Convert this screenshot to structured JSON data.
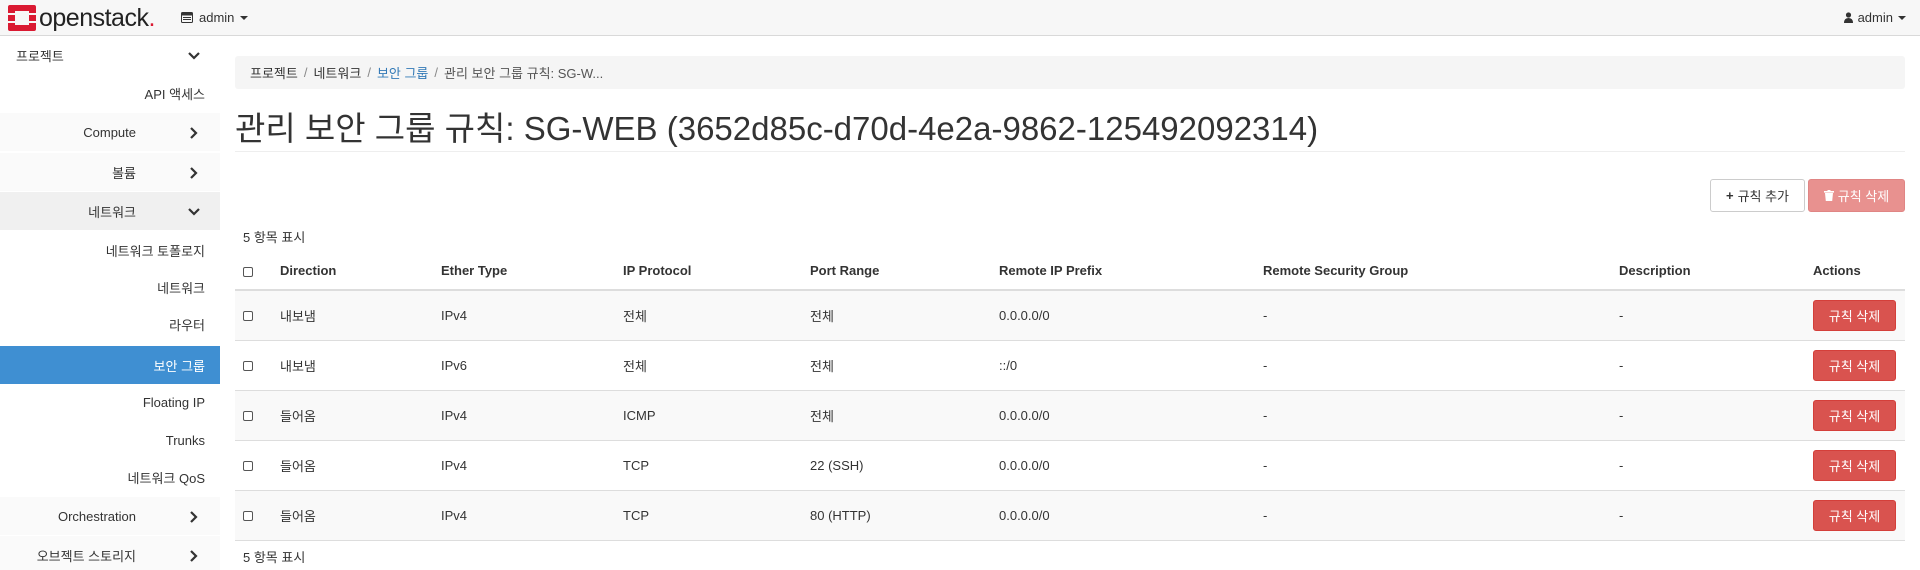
{
  "navbar": {
    "brand": "openstack",
    "brand_dot": ".",
    "project_label": "admin",
    "user_label": "admin"
  },
  "sidebar": {
    "items": [
      {
        "label": "프로젝트"
      },
      {
        "label": "API 액세스"
      },
      {
        "label": "Compute"
      },
      {
        "label": "볼륨"
      },
      {
        "label": "네트워크"
      },
      {
        "label": "네트워크 토폴로지"
      },
      {
        "label": "네트워크"
      },
      {
        "label": "라우터"
      },
      {
        "label": "보안 그룹"
      },
      {
        "label": "Floating IP"
      },
      {
        "label": "Trunks"
      },
      {
        "label": "네트워크 QoS"
      },
      {
        "label": "Orchestration"
      },
      {
        "label": "오브젝트 스토리지"
      }
    ]
  },
  "breadcrumb": {
    "items": [
      "프로젝트",
      "네트워크",
      "보안 그룹",
      "관리 보안 그룹 규칙: SG-W..."
    ],
    "separator": "/"
  },
  "page_title": "관리 보안 그룹 규칙: SG-WEB (3652d85c-d70d-4e2a-9862-125492092314)",
  "actions": {
    "add_label": "규칙 추가",
    "delete_label": "규칙 삭제"
  },
  "count_text": "5 항목 표시",
  "table": {
    "columns": [
      "Direction",
      "Ether Type",
      "IP Protocol",
      "Port Range",
      "Remote IP Prefix",
      "Remote Security Group",
      "Description",
      "Actions"
    ],
    "rows": [
      {
        "direction": "내보냄",
        "ether": "IPv4",
        "protocol": "전체",
        "port": "전체",
        "prefix": "0.0.0.0/0",
        "group": "-",
        "desc": "-",
        "action": "규칙 삭제"
      },
      {
        "direction": "내보냄",
        "ether": "IPv6",
        "protocol": "전체",
        "port": "전체",
        "prefix": "::/0",
        "group": "-",
        "desc": "-",
        "action": "규칙 삭제"
      },
      {
        "direction": "들어옴",
        "ether": "IPv4",
        "protocol": "ICMP",
        "port": "전체",
        "prefix": "0.0.0.0/0",
        "group": "-",
        "desc": "-",
        "action": "규칙 삭제"
      },
      {
        "direction": "들어옴",
        "ether": "IPv4",
        "protocol": "TCP",
        "port": "22 (SSH)",
        "prefix": "0.0.0.0/0",
        "group": "-",
        "desc": "-",
        "action": "규칙 삭제"
      },
      {
        "direction": "들어옴",
        "ether": "IPv4",
        "protocol": "TCP",
        "port": "80 (HTTP)",
        "prefix": "0.0.0.0/0",
        "group": "-",
        "desc": "-",
        "action": "규칙 삭제"
      }
    ]
  },
  "colors": {
    "active_nav": "#3f8fd2",
    "danger": "#d9534f",
    "danger_disabled": "#e8918f",
    "link": "#337ab7",
    "brand_red": "#da1a32"
  }
}
